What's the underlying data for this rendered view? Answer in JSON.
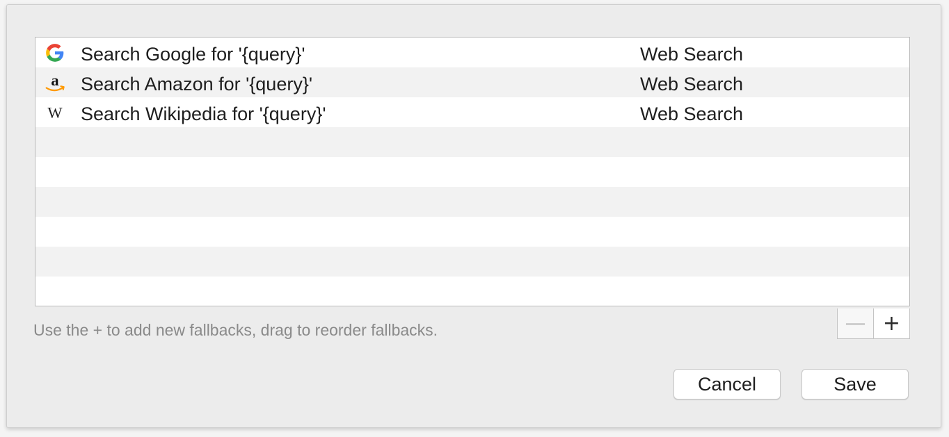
{
  "fallbacks": [
    {
      "icon": "google-icon",
      "label": "Search Google for '{query}'",
      "kind": "Web Search"
    },
    {
      "icon": "amazon-icon",
      "label": "Search Amazon for '{query}'",
      "kind": "Web Search"
    },
    {
      "icon": "wikipedia-icon",
      "label": "Search Wikipedia for '{query}'",
      "kind": "Web Search"
    }
  ],
  "hint": "Use the + to add new fallbacks, drag to reorder fallbacks.",
  "controls": {
    "remove_label": "—",
    "add_label": "+"
  },
  "buttons": {
    "cancel_label": "Cancel",
    "save_label": "Save"
  },
  "colors": {
    "google_blue": "#4285F4",
    "google_red": "#EA4335",
    "google_yellow": "#FBBC05",
    "google_green": "#34A853",
    "amazon_orange": "#FF9900"
  }
}
